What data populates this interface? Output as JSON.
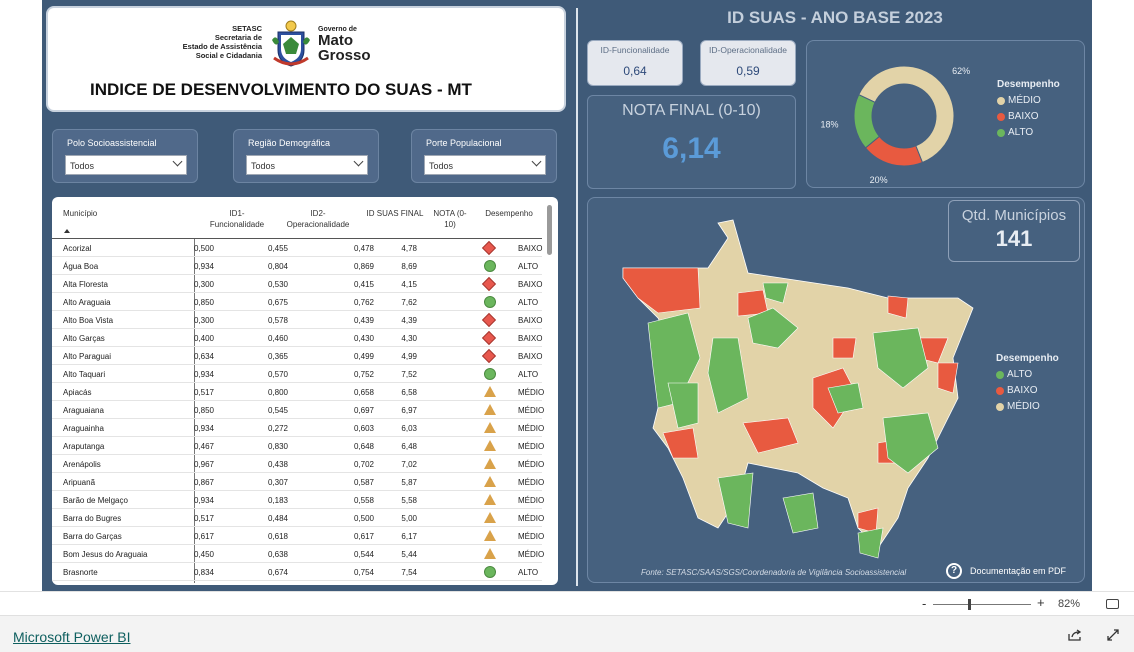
{
  "header": {
    "logo_left_lines": [
      "SETASC",
      "Secretaria de",
      "Estado de Assistência",
      "Social e Cidadania"
    ],
    "logo_gov_small": "Governo de",
    "logo_gov_line1": "Mato",
    "logo_gov_line2": "Grosso",
    "title": "INDICE DE DESENVOLVIMENTO DO SUAS - MT"
  },
  "slicers": [
    {
      "label": "Polo Socioassistencial",
      "value": "Todos"
    },
    {
      "label": "Região Demográfica",
      "value": "Todos"
    },
    {
      "label": "Porte Populacional",
      "value": "Todos"
    }
  ],
  "table": {
    "headers": {
      "municipio": "Município",
      "id1": "ID1-\nFuncionalidade",
      "id2": "ID2-\nOperacionalidade",
      "id_final": "ID SUAS FINAL",
      "nota": "NOTA (0-\n10)",
      "desempenho": "Desempenho"
    },
    "rows": [
      {
        "municipio": "Acorizal",
        "id1": "0,500",
        "id2": "0,455",
        "final": "0,478",
        "nota": "4,78",
        "icon": "diamond",
        "desempenho": "BAIXO"
      },
      {
        "municipio": "Água Boa",
        "id1": "0,934",
        "id2": "0,804",
        "final": "0,869",
        "nota": "8,69",
        "icon": "circle",
        "desempenho": "ALTO"
      },
      {
        "municipio": "Alta Floresta",
        "id1": "0,300",
        "id2": "0,530",
        "final": "0,415",
        "nota": "4,15",
        "icon": "diamond",
        "desempenho": "BAIXO"
      },
      {
        "municipio": "Alto Araguaia",
        "id1": "0,850",
        "id2": "0,675",
        "final": "0,762",
        "nota": "7,62",
        "icon": "circle",
        "desempenho": "ALTO"
      },
      {
        "municipio": "Alto Boa Vista",
        "id1": "0,300",
        "id2": "0,578",
        "final": "0,439",
        "nota": "4,39",
        "icon": "diamond",
        "desempenho": "BAIXO"
      },
      {
        "municipio": "Alto Garças",
        "id1": "0,400",
        "id2": "0,460",
        "final": "0,430",
        "nota": "4,30",
        "icon": "diamond",
        "desempenho": "BAIXO"
      },
      {
        "municipio": "Alto Paraguai",
        "id1": "0,634",
        "id2": "0,365",
        "final": "0,499",
        "nota": "4,99",
        "icon": "diamond",
        "desempenho": "BAIXO"
      },
      {
        "municipio": "Alto Taquari",
        "id1": "0,934",
        "id2": "0,570",
        "final": "0,752",
        "nota": "7,52",
        "icon": "circle",
        "desempenho": "ALTO"
      },
      {
        "municipio": "Apiacás",
        "id1": "0,517",
        "id2": "0,800",
        "final": "0,658",
        "nota": "6,58",
        "icon": "triangle",
        "desempenho": "MÉDIO"
      },
      {
        "municipio": "Araguaiana",
        "id1": "0,850",
        "id2": "0,545",
        "final": "0,697",
        "nota": "6,97",
        "icon": "triangle",
        "desempenho": "MÉDIO"
      },
      {
        "municipio": "Araguainha",
        "id1": "0,934",
        "id2": "0,272",
        "final": "0,603",
        "nota": "6,03",
        "icon": "triangle",
        "desempenho": "MÉDIO"
      },
      {
        "municipio": "Araputanga",
        "id1": "0,467",
        "id2": "0,830",
        "final": "0,648",
        "nota": "6,48",
        "icon": "triangle",
        "desempenho": "MÉDIO"
      },
      {
        "municipio": "Arenápolis",
        "id1": "0,967",
        "id2": "0,438",
        "final": "0,702",
        "nota": "7,02",
        "icon": "triangle",
        "desempenho": "MÉDIO"
      },
      {
        "municipio": "Aripuanã",
        "id1": "0,867",
        "id2": "0,307",
        "final": "0,587",
        "nota": "5,87",
        "icon": "triangle",
        "desempenho": "MÉDIO"
      },
      {
        "municipio": "Barão de Melgaço",
        "id1": "0,934",
        "id2": "0,183",
        "final": "0,558",
        "nota": "5,58",
        "icon": "triangle",
        "desempenho": "MÉDIO"
      },
      {
        "municipio": "Barra do Bugres",
        "id1": "0,517",
        "id2": "0,484",
        "final": "0,500",
        "nota": "5,00",
        "icon": "triangle",
        "desempenho": "MÉDIO"
      },
      {
        "municipio": "Barra do Garças",
        "id1": "0,617",
        "id2": "0,618",
        "final": "0,617",
        "nota": "6,17",
        "icon": "triangle",
        "desempenho": "MÉDIO"
      },
      {
        "municipio": "Bom Jesus do Araguaia",
        "id1": "0,450",
        "id2": "0,638",
        "final": "0,544",
        "nota": "5,44",
        "icon": "triangle",
        "desempenho": "MÉDIO"
      },
      {
        "municipio": "Brasnorte",
        "id1": "0,834",
        "id2": "0,674",
        "final": "0,754",
        "nota": "7,54",
        "icon": "circle",
        "desempenho": "ALTO"
      }
    ]
  },
  "right_title": "ID SUAS - ANO BASE 2023",
  "kpis": {
    "funcionalidade_label": "ID-Funcionalidade",
    "funcionalidade_value": "0,64",
    "operacionalidade_label": "ID-Operacionalidade",
    "operacionalidade_value": "0,59",
    "nota_label": "NOTA FINAL (0-10)",
    "nota_value": "6,14"
  },
  "chart_data": {
    "type": "pie",
    "title": "",
    "legend_title": "Desempenho",
    "legend_placement": "right",
    "series": [
      {
        "name": "MÉDIO",
        "value": 62,
        "label": "62%",
        "color": "#e2d3a8"
      },
      {
        "name": "BAIXO",
        "value": 20,
        "label": "20%",
        "color": "#e85a40"
      },
      {
        "name": "ALTO",
        "value": 18,
        "label": "18%",
        "color": "#6bb65d"
      }
    ]
  },
  "map": {
    "qtd_label": "Qtd. Municípios",
    "qtd_value": "141",
    "legend_title": "Desempenho",
    "legend": [
      {
        "label": "ALTO",
        "color": "#6bb65d"
      },
      {
        "label": "BAIXO",
        "color": "#e85a40"
      },
      {
        "label": "MÉDIO",
        "color": "#e2d3a8"
      }
    ],
    "source": "Fonte: SETASC/SAAS/SGS/Coordenadoria de Vigilância Socioassistencial",
    "doc_label": "Documentação em PDF"
  },
  "zoom": {
    "minus": "-",
    "plus": "+",
    "percent": "82%"
  },
  "footer": {
    "link": "Microsoft Power BI"
  }
}
